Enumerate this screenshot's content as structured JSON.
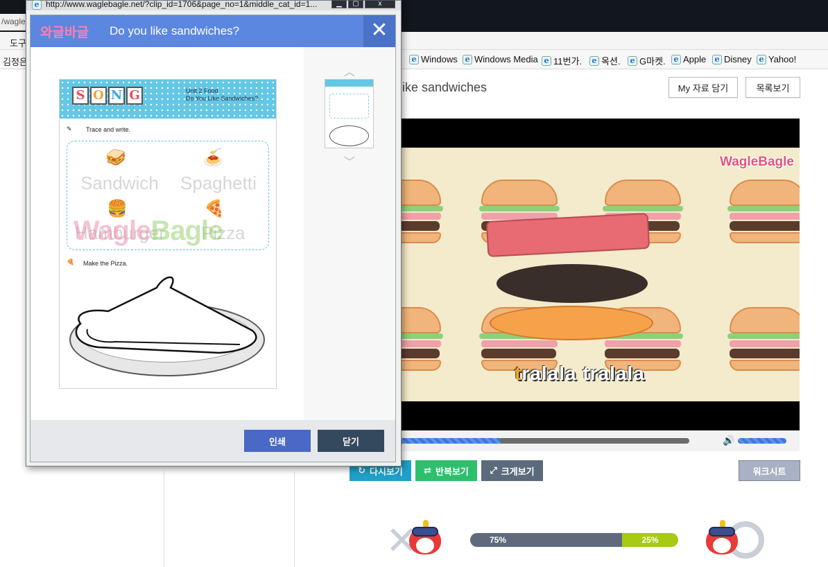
{
  "browser": {
    "address_partial": "/wagle",
    "menu_partial": "도구",
    "user_partial": "김정은",
    "favorites": [
      "Windows",
      "Windows Media",
      "11번가.",
      "옥션.",
      "G마켓.",
      "Apple",
      "Disney",
      "Yahoo!"
    ]
  },
  "page": {
    "video_title": "like sandwiches",
    "btn_my": "My 자료 담기",
    "btn_list": "목록보기",
    "video_logo": "WagleBagle",
    "subtitle_first": "t",
    "subtitle_rest": "ralala tralala",
    "progress_fraction": 0.35,
    "volume_fraction": 1.0,
    "btn_replay": "다시보기",
    "btn_repeat": "반복보기",
    "btn_fullscreen": "크게보기",
    "btn_worksheet": "워크시트",
    "vote_left": "75%",
    "vote_right": "25%",
    "vote_left_fraction": 0.73
  },
  "popup": {
    "url": "http://www.waglebagle.net/?clip_id=1706&page_no=1&middle_cat_id=1...",
    "logo": "와글바글",
    "title": "Do you like sandwiches?",
    "close_glyph": "✕",
    "btn_print": "인쇄",
    "btn_close": "닫기",
    "worksheet": {
      "song_letters": [
        "S",
        "O",
        "N",
        "G"
      ],
      "unit": "Unit 2 Food",
      "unit_title": "Do You Like Sandwiches?",
      "task1": "Trace and write.",
      "words": [
        "Sandwich",
        "Spaghetti",
        "Hamburger",
        "Pizza"
      ],
      "watermark_a": "Wagle",
      "watermark_b": "Bagle",
      "task2": "Make the Pizza."
    }
  },
  "colors": {
    "popup_header": "#5b87e0",
    "btn_print": "#4a69c6",
    "btn_close": "#34495e",
    "btn_replay": "#1fa0c8",
    "btn_repeat": "#2ebf6c",
    "btn_fullscreen": "#5c6b7b",
    "vote_right": "#a6cb12"
  }
}
